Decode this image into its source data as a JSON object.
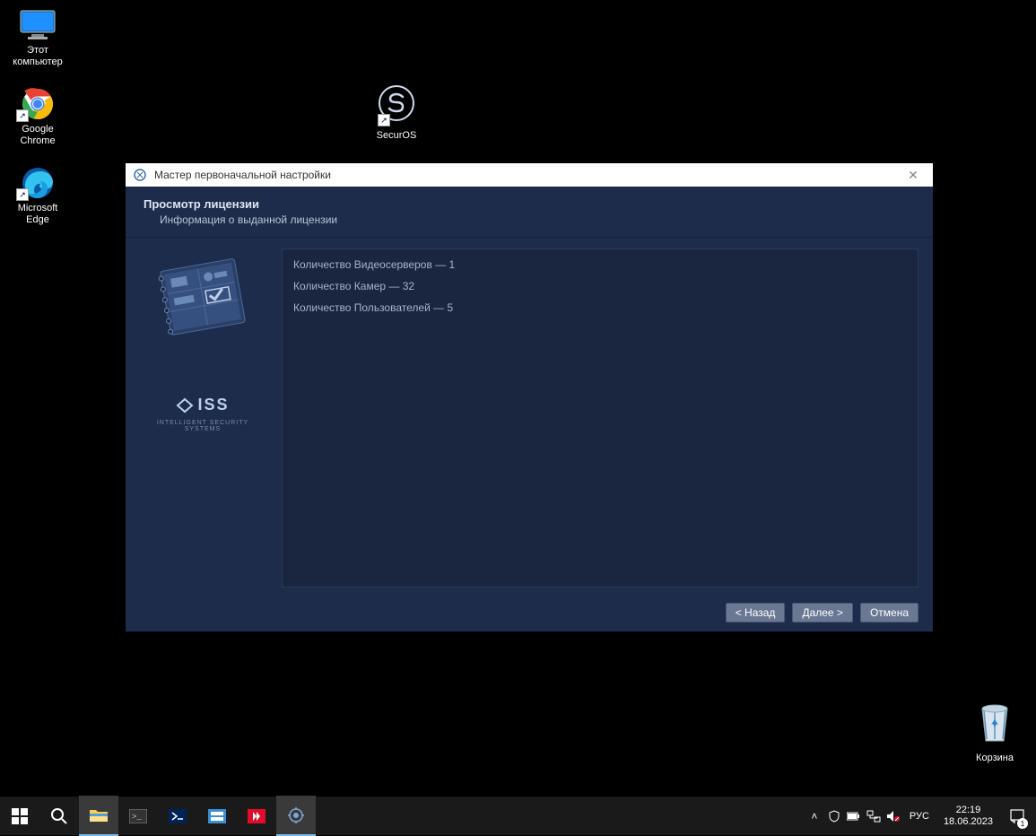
{
  "desktop": {
    "icons": [
      {
        "label": "Этот\nкомпьютер"
      },
      {
        "label": "Google\nChrome"
      },
      {
        "label": "Microsoft\nEdge"
      }
    ],
    "securos_label": "SecurOS",
    "recycle_label": "Корзина"
  },
  "window": {
    "title": "Мастер первоначальной настройки",
    "heading": "Просмотр лицензии",
    "subheading": "Информация о выданной лицензии",
    "license_lines": [
      "Количество Видеосерверов — 1",
      "Количество Камер — 32",
      "Количество Пользователей — 5"
    ],
    "brand": "ISS",
    "brand_sub": "INTELLIGENT SECURITY SYSTEMS",
    "buttons": {
      "back": "< Назад",
      "next": "Далее >",
      "cancel": "Отмена"
    }
  },
  "taskbar": {
    "lang": "РУС",
    "time": "22:19",
    "date": "18.06.2023",
    "notif_count": "1"
  }
}
